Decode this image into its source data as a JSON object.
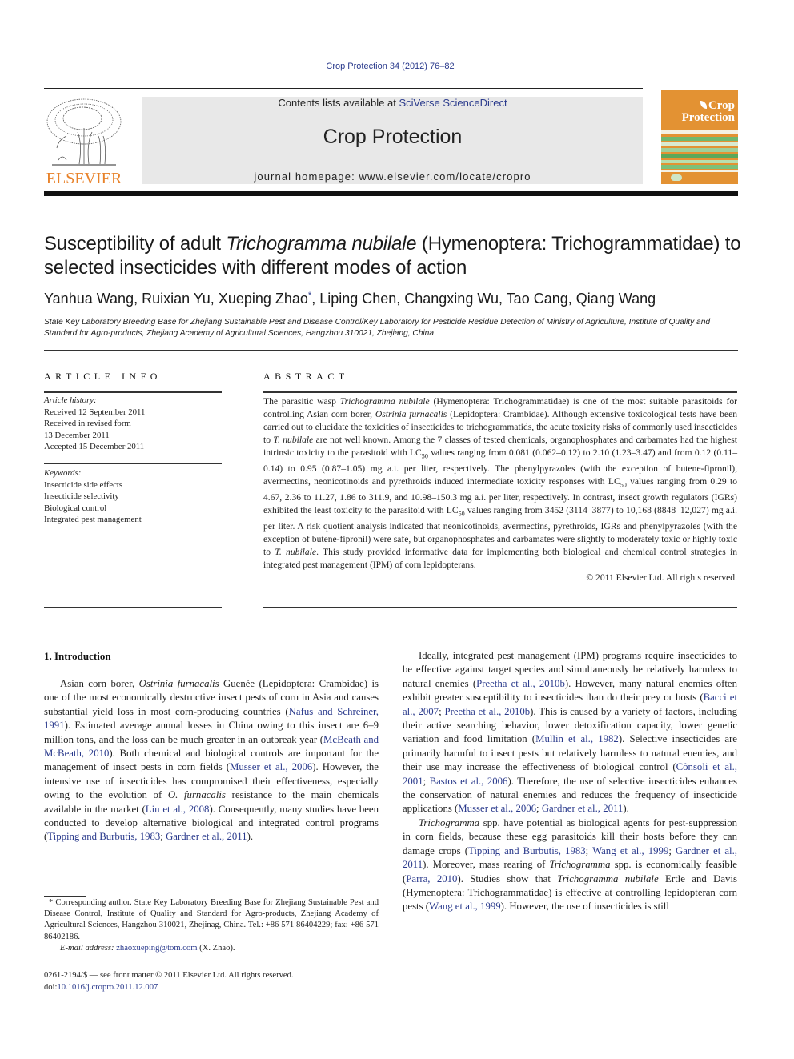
{
  "header": {
    "citation": "Crop Protection 34 (2012) 76–82",
    "contents_prefix": "Contents lists available at ",
    "contents_link": "SciVerse ScienceDirect",
    "journal_name": "Crop Protection",
    "homepage": "journal homepage: www.elsevier.com/locate/cropro",
    "publisher_logo_text": "ELSEVIER",
    "cover_title_line1": "Crop",
    "cover_title_line2": "Protection",
    "colors": {
      "publisher_orange": "#e8822a",
      "cover_orange": "#e39233",
      "cover_green": "#6fb86f",
      "link_blue": "#2a3a8c"
    }
  },
  "article": {
    "title_part1": "Susceptibility of adult ",
    "title_italic": "Trichogramma nubilale",
    "title_part2": " (Hymenoptera: Trichogrammatidae) to selected insecticides with different modes of action",
    "authors_before": "Yanhua Wang, Ruixian Yu, Xueping Zhao",
    "authors_mark": "*",
    "authors_after": ", Liping Chen, Changxing Wu, Tao Cang, Qiang Wang",
    "affiliation": "State Key Laboratory Breeding Base for Zhejiang Sustainable Pest and Disease Control/Key Laboratory for Pesticide Residue Detection of Ministry of Agriculture, Institute of Quality and Standard for Agro-products, Zhejiang Academy of Agricultural Sciences, Hangzhou 310021, Zhejiang, China"
  },
  "article_info": {
    "heading": "ARTICLE INFO",
    "history_label": "Article history:",
    "history": [
      "Received 12 September 2011",
      "Received in revised form",
      "13 December 2011",
      "Accepted 15 December 2011"
    ],
    "keywords_label": "Keywords:",
    "keywords": [
      "Insecticide side effects",
      "Insecticide selectivity",
      "Biological control",
      "Integrated pest management"
    ]
  },
  "abstract": {
    "heading": "ABSTRACT",
    "s1": "The parasitic wasp ",
    "s1i": "Trichogramma nubilale",
    "s2": " (Hymenoptera: Trichogrammatidae) is one of the most suitable parasitoids for controlling Asian corn borer, ",
    "s2i": "Ostrinia furnacalis",
    "s3": " (Lepidoptera: Crambidae). Although extensive toxicological tests have been carried out to elucidate the toxicities of insecticides to trichogrammatids, the acute toxicity risks of commonly used insecticides to ",
    "s3i": "T. nubilale",
    "s4": " are not well known. Among the 7 classes of tested chemicals, organophosphates and carbamates had the highest intrinsic toxicity to the parasitoid with LC",
    "sub": "50",
    "s5": " values ranging from 0.081 (0.062–0.12) to 2.10 (1.23–3.47) and from 0.12 (0.11–0.14) to 0.95 (0.87–1.05) mg a.i. per liter, respectively. The phenylpyrazoles (with the exception of butene-fipronil), avermectins, neonicotinoids and pyrethroids induced intermediate toxicity responses with LC",
    "s6": " values ranging from 0.29 to 4.67, 2.36 to 11.27, 1.86 to 311.9, and 10.98–150.3 mg a.i. per liter, respectively. In contrast, insect growth regulators (IGRs) exhibited the least toxicity to the parasitoid with LC",
    "s7": " values ranging from 3452 (3114–3877) to 10,168 (8848–12,027) mg a.i. per liter. A risk quotient analysis indicated that neonicotinoids, avermectins, pyrethroids, IGRs and phenylpyrazoles (with the exception of butene-fipronil) were safe, but organophosphates and carbamates were slightly to moderately toxic or highly toxic to ",
    "s7i": "T. nubilale",
    "s8": ". This study provided informative data for implementing both biological and chemical control strategies in integrated pest management (IPM) of corn lepidopterans.",
    "copyright": "© 2011 Elsevier Ltd. All rights reserved."
  },
  "introduction": {
    "heading": "1.  Introduction",
    "p1": [
      {
        "t": "Asian corn borer, "
      },
      {
        "i": "Ostrinia furnacalis"
      },
      {
        "t": " Guenée (Lepidoptera: Crambidae) is one of the most economically destructive insect pests of corn in Asia and causes substantial yield loss in most corn-producing countries ("
      },
      {
        "l": "Nafus and Schreiner, 1991"
      },
      {
        "t": "). Estimated average annual losses in China owing to this insect are 6–9 million tons, and the loss can be much greater in an outbreak year ("
      },
      {
        "l": "McBeath and McBeath, 2010"
      },
      {
        "t": "). Both chemical and biological controls are important for the management of insect pests in corn fields ("
      },
      {
        "l": "Musser et al., 2006"
      },
      {
        "t": "). However, the intensive use of insecticides has compromised their effectiveness, especially owing to the evolution of "
      },
      {
        "i": "O. furnacalis"
      },
      {
        "t": " resistance to the main chemicals available in the market ("
      },
      {
        "l": "Lin et al., 2008"
      },
      {
        "t": "). Consequently, many studies have been conducted to develop alternative biological and integrated control programs ("
      },
      {
        "l": "Tipping and Burbutis, 1983"
      },
      {
        "t": "; "
      },
      {
        "l": "Gardner et al., 2011"
      },
      {
        "t": ")."
      }
    ],
    "p2": [
      {
        "t": "Ideally, integrated pest management (IPM) programs require insecticides to be effective against target species and simultaneously be relatively harmless to natural enemies ("
      },
      {
        "l": "Preetha et al., 2010b"
      },
      {
        "t": "). However, many natural enemies often exhibit greater susceptibility to insecticides than do their prey or hosts ("
      },
      {
        "l": "Bacci et al., 2007"
      },
      {
        "t": "; "
      },
      {
        "l": "Preetha et al., 2010b"
      },
      {
        "t": "). This is caused by a variety of factors, including their active searching behavior, lower detoxification capacity, lower genetic variation and food limitation ("
      },
      {
        "l": "Mullin et al., 1982"
      },
      {
        "t": "). Selective insecticides are primarily harmful to insect pests but relatively harmless to natural enemies, and their use may increase the effectiveness of biological control ("
      },
      {
        "l": "Cônsoli et al., 2001"
      },
      {
        "t": "; "
      },
      {
        "l": "Bastos et al., 2006"
      },
      {
        "t": "). Therefore, the use of selective insecticides enhances the conservation of natural enemies and reduces the frequency of insecticide applications ("
      },
      {
        "l": "Musser et al., 2006"
      },
      {
        "t": "; "
      },
      {
        "l": "Gardner et al., 2011"
      },
      {
        "t": ")."
      }
    ],
    "p3": [
      {
        "i": "Trichogramma"
      },
      {
        "t": " spp. have potential as biological agents for pest-suppression in corn fields, because these egg parasitoids kill their hosts before they can damage crops ("
      },
      {
        "l": "Tipping and Burbutis, 1983"
      },
      {
        "t": "; "
      },
      {
        "l": "Wang et al., 1999"
      },
      {
        "t": "; "
      },
      {
        "l": "Gardner et al., 2011"
      },
      {
        "t": "). Moreover, mass rearing of "
      },
      {
        "i": "Trichogramma"
      },
      {
        "t": " spp. is economically feasible ("
      },
      {
        "l": "Parra, 2010"
      },
      {
        "t": "). Studies show that "
      },
      {
        "i": "Trichogramma nubilale"
      },
      {
        "t": " Ertle and Davis (Hymenoptera: Trichogrammatidae) is effective at controlling lepidopteran corn pests ("
      },
      {
        "l": "Wang et al., 1999"
      },
      {
        "t": "). However, the use of insecticides is still"
      }
    ]
  },
  "footnote": {
    "mark": "*",
    "text": " Corresponding author. State Key Laboratory Breeding Base for Zhejiang Sustainable Pest and Disease Control, Institute of Quality and Standard for Agro-products, Zhejiang Academy of Agricultural Sciences, Hangzhou 310021, Zhejinag, China. Tel.: +86 571 86404229; fax: +86 571 86402186.",
    "email_label": "E-mail address: ",
    "email": "zhaoxueping@tom.com",
    "email_suffix": " (X. Zhao)."
  },
  "front_matter": {
    "issn_line": "0261-2194/$ — see front matter © 2011 Elsevier Ltd. All rights reserved.",
    "doi_prefix": "doi:",
    "doi": "10.1016/j.cropro.2011.12.007"
  }
}
